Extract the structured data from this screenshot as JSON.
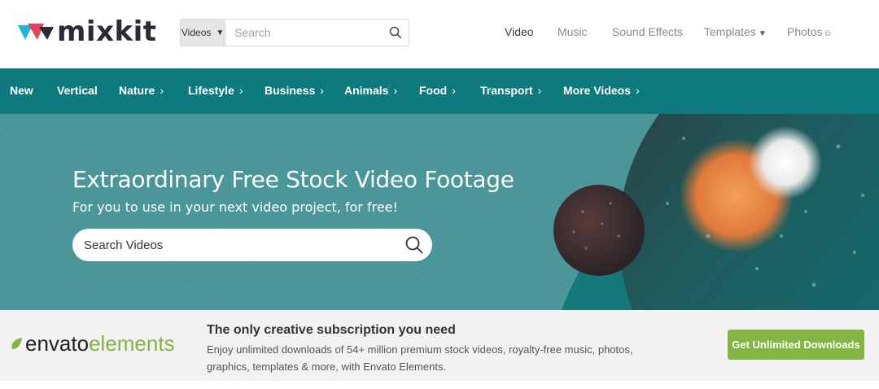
{
  "brand": {
    "name": "mixkit"
  },
  "search": {
    "type_selected": "Videos",
    "placeholder": "Search"
  },
  "topnav": [
    {
      "label": "Video",
      "active": true
    },
    {
      "label": "Music"
    },
    {
      "label": "Sound Effects"
    },
    {
      "label": "Templates",
      "has_dropdown": true
    },
    {
      "label": "Photos",
      "external": true
    }
  ],
  "categories": [
    {
      "label": "New"
    },
    {
      "label": "Vertical"
    },
    {
      "label": "Nature",
      "chevron": "›"
    },
    {
      "label": "Lifestyle",
      "chevron": "›"
    },
    {
      "label": "Business",
      "chevron": "›"
    },
    {
      "label": "Animals",
      "chevron": "›"
    },
    {
      "label": "Food",
      "chevron": "›"
    },
    {
      "label": "Transport",
      "chevron": "›"
    },
    {
      "label": "More Videos",
      "chevron": "›"
    }
  ],
  "hero": {
    "title": "Extraordinary Free Stock Video Footage",
    "subtitle": "For you to use in your next video project, for free!",
    "search_placeholder": "Search Videos"
  },
  "promo": {
    "logo_part1": "envato",
    "logo_part2": "elements",
    "heading": "The only creative subscription you need",
    "body": "Enjoy unlimited downloads of 54+ million premium stock videos, royalty-free music, photos, graphics, templates & more, with Envato Elements.",
    "button": "Get Unlimited Downloads"
  },
  "colors": {
    "teal_bar": "#0f7a7d",
    "hero_bg": "#4a9699",
    "accent_green": "#82b541",
    "promo_bg": "#f2f2f2"
  },
  "icons": {
    "search": "search-icon",
    "caret": "caret-down-icon",
    "external": "external-link-icon",
    "chevron": "chevron-right-icon"
  }
}
